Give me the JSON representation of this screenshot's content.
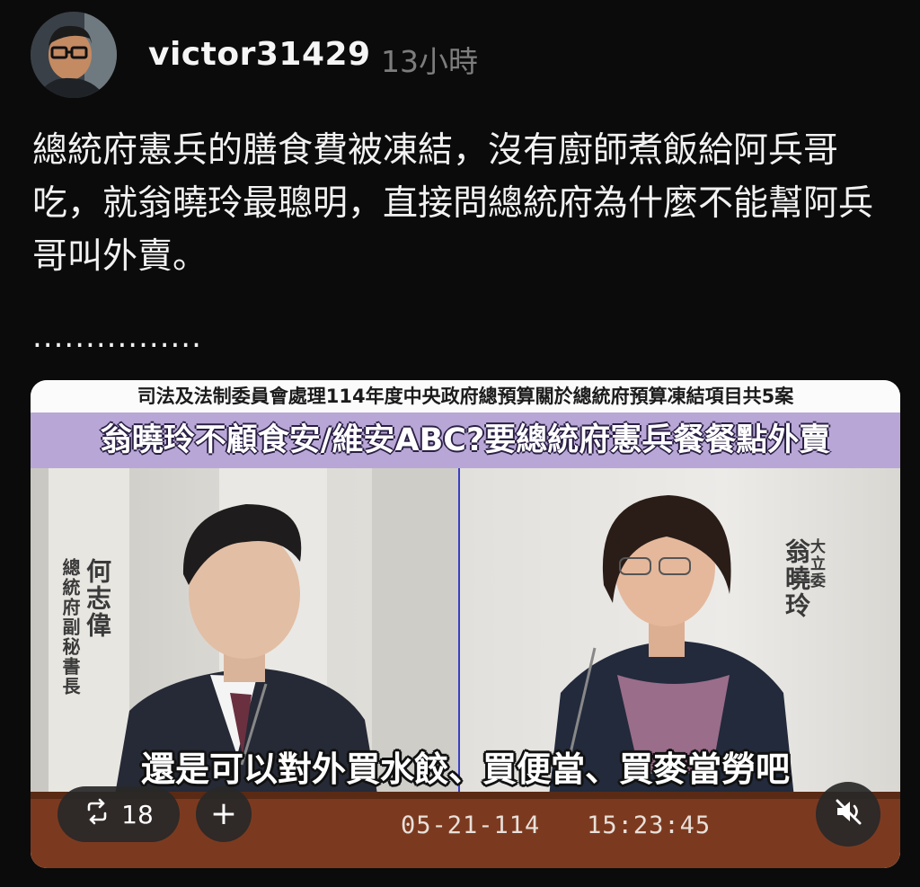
{
  "post": {
    "username": "victor31429",
    "time": "13小時",
    "text": "總統府憲兵的膳食費被凍結，沒有廚師煮飯給阿兵哥吃，就翁曉玲最聰明，直接問總統府為什麼不能幫阿兵哥叫外賣。",
    "ellipsis": "................"
  },
  "video": {
    "header_top": "司法及法制委員會處理114年度中央政府總預算關於總統府預算凍結項目共5案",
    "header_main": "翁曉玲不顧食安/維安ABC?要總統府憲兵餐餐點外賣",
    "left_speaker_title": "總統府副秘書長",
    "left_speaker_name": "何志偉",
    "right_speaker_title": "大立委",
    "right_speaker_name": "翁曉玲",
    "subtitle": "還是可以對外買水餃、買便當、買麥當勞吧",
    "datestamp": "05-21-114   15:23:45"
  },
  "actions": {
    "repost_count": "18",
    "add_label": "+"
  },
  "icons": {
    "repost": "repost-icon",
    "add": "plus-icon",
    "mute": "muted-speaker-icon"
  },
  "colors": {
    "background": "#0b0b0b",
    "header_band": "#b8a7d6",
    "divider": "#3a3fc4"
  }
}
